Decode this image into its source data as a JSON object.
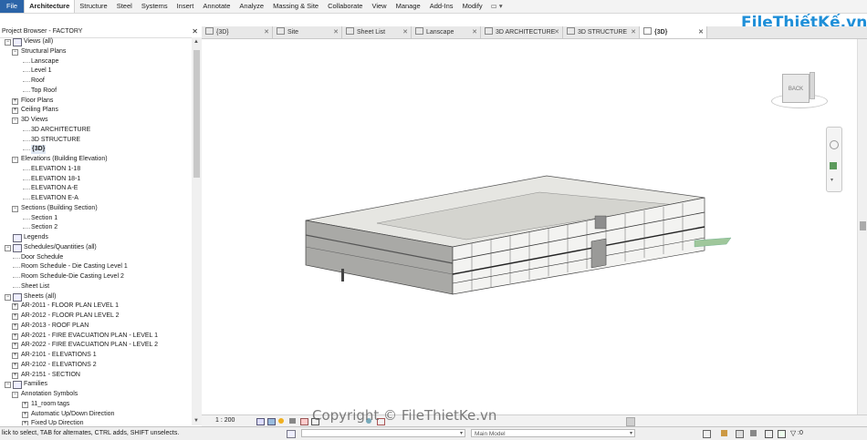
{
  "ribbon": {
    "tabs": [
      "File",
      "Architecture",
      "Structure",
      "Steel",
      "Systems",
      "Insert",
      "Annotate",
      "Analyze",
      "Massing & Site",
      "Collaborate",
      "View",
      "Manage",
      "Add-Ins",
      "Modify"
    ],
    "active": "Architecture",
    "extra": "▭ ▾"
  },
  "browser": {
    "title": "Project Browser - FACTORY",
    "close": "✕",
    "selected": "{3D}",
    "tree": [
      {
        "label": "Views (all)",
        "level": 0,
        "expander": "−",
        "icon": "views-icon"
      },
      {
        "label": "Structural Plans",
        "level": 1,
        "expander": "−"
      },
      {
        "label": "Lanscape",
        "level": 2
      },
      {
        "label": "Level 1",
        "level": 2
      },
      {
        "label": "Roof",
        "level": 2
      },
      {
        "label": "Top Roof",
        "level": 2
      },
      {
        "label": "Floor Plans",
        "level": 1,
        "expander": "+"
      },
      {
        "label": "Ceiling Plans",
        "level": 1,
        "expander": "+"
      },
      {
        "label": "3D Views",
        "level": 1,
        "expander": "−"
      },
      {
        "label": "3D ARCHITECTURE",
        "level": 2
      },
      {
        "label": "3D STRUCTURE",
        "level": 2
      },
      {
        "label": "{3D}",
        "level": 2
      },
      {
        "label": "Elevations (Building Elevation)",
        "level": 1,
        "expander": "−"
      },
      {
        "label": "ELEVATION 1-18",
        "level": 2
      },
      {
        "label": "ELEVATION 18-1",
        "level": 2
      },
      {
        "label": "ELEVATION A-E",
        "level": 2
      },
      {
        "label": "ELEVATION E-A",
        "level": 2
      },
      {
        "label": "Sections (Building Section)",
        "level": 1,
        "expander": "−"
      },
      {
        "label": "Section 1",
        "level": 2
      },
      {
        "label": "Section 2",
        "level": 2
      },
      {
        "label": "Legends",
        "level": 0,
        "icon": "legend-icon"
      },
      {
        "label": "Schedules/Quantities (all)",
        "level": 0,
        "expander": "−",
        "icon": "schedule-icon"
      },
      {
        "label": "Door Schedule",
        "level": 1
      },
      {
        "label": "Room Schedule - Die Casting Level 1",
        "level": 1
      },
      {
        "label": "Room Schedule-Die Casting Level 2",
        "level": 1
      },
      {
        "label": "Sheet List",
        "level": 1
      },
      {
        "label": "Sheets (all)",
        "level": 0,
        "expander": "−",
        "icon": "sheets-icon"
      },
      {
        "label": "AR-2011 - FLOOR PLAN LEVEL 1",
        "level": 1,
        "expander": "+"
      },
      {
        "label": "AR-2012 - FLOOR PLAN LEVEL 2",
        "level": 1,
        "expander": "+"
      },
      {
        "label": "AR-2013 - ROOF PLAN",
        "level": 1,
        "expander": "+"
      },
      {
        "label": "AR-2021 - FIRE EVACUATION PLAN - LEVEL 1",
        "level": 1,
        "expander": "+"
      },
      {
        "label": "AR-2022 - FIRE EVACUATION PLAN - LEVEL 2",
        "level": 1,
        "expander": "+"
      },
      {
        "label": "AR-2101 - ELEVATIONS 1",
        "level": 1,
        "expander": "+"
      },
      {
        "label": "AR-2102 - ELEVATIONS 2",
        "level": 1,
        "expander": "+"
      },
      {
        "label": "AR-2151 - SECTION",
        "level": 1,
        "expander": "+"
      },
      {
        "label": "Families",
        "level": 0,
        "expander": "−",
        "icon": "families-icon"
      },
      {
        "label": "Annotation Symbols",
        "level": 1,
        "expander": "−"
      },
      {
        "label": "11_room tags",
        "level": 2,
        "expander": "+"
      },
      {
        "label": "Automatic Up/Down Direction",
        "level": 2,
        "expander": "+"
      },
      {
        "label": "Fixed Up Direction",
        "level": 2,
        "expander": "+"
      }
    ]
  },
  "view_tabs": [
    {
      "label": "{3D}",
      "active": false
    },
    {
      "label": "Site",
      "active": false
    },
    {
      "label": "Sheet List",
      "active": false
    },
    {
      "label": "Lanscape",
      "active": false
    },
    {
      "label": "3D ARCHITECTURE",
      "active": false
    },
    {
      "label": "3D STRUCTURE",
      "active": false
    },
    {
      "label": "{3D}",
      "active": true
    }
  ],
  "viewcube": {
    "face": "BACK"
  },
  "viewbar": {
    "scale": "1 : 200"
  },
  "status": {
    "hint": "lick to select, TAB for alternates, CTRL adds, SHIFT unselects.",
    "model": "Main Model",
    "filter_count": ":0"
  },
  "watermark": {
    "logo": "FileThiếtKế.vn",
    "copyright": "Copyright © FileThietKe.vn"
  }
}
